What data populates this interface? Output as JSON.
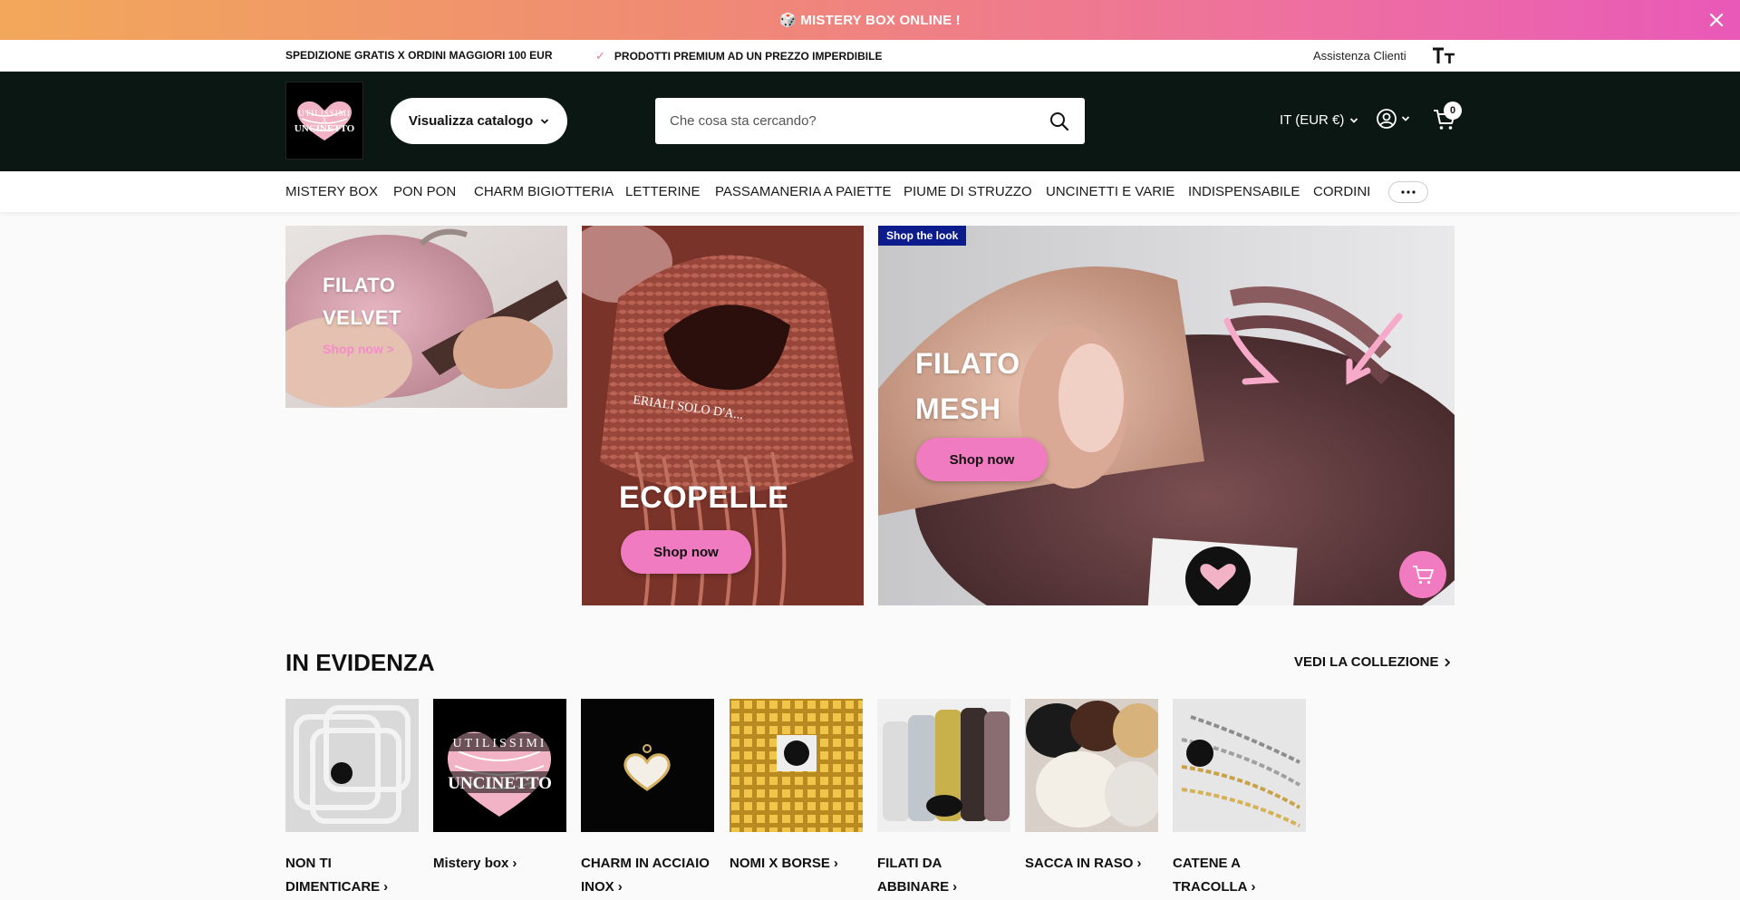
{
  "announcement": {
    "text": "🎲 MISTERY BOX ONLINE !",
    "close_icon": "close-icon"
  },
  "utility": {
    "usp_1": "SPEDIZIONE GRATIS X ORDINI MAGGIORI 100 EUR",
    "usp_2_check": "✓",
    "usp_2": "PRODOTTI PREMIUM AD UN PREZZO IMPERDIBILE",
    "help": "Assistenza Clienti",
    "text_size_icon": "text-size-icon"
  },
  "header": {
    "logo": {
      "line1": "UTILISSIMI",
      "line2": "X",
      "line3": "UNCINETTO"
    },
    "catalog_button": "Visualizza catalogo",
    "search_placeholder": "Che cosa sta cercando?",
    "locale": "IT (EUR €)",
    "cart_count": "0"
  },
  "nav": {
    "items": [
      "MISTERY BOX",
      "PON PON",
      "CHARM BIGIOTTERIA",
      "LETTERINE",
      "PASSAMANERIA A PAIETTE",
      "PIUME DI STRUZZO",
      "UNCINETTI E VARIE",
      "INDISPENSABILE",
      "CORDINI"
    ],
    "more_icon": "more-dots-icon"
  },
  "hero": {
    "velvet": {
      "title_1": "FILATO",
      "title_2": "VELVET",
      "link": "Shop now >"
    },
    "ecopelle": {
      "title": "ECOPELLE",
      "button": "Shop now",
      "photo_text": "ERIALI SOLO D'A..."
    },
    "mesh": {
      "tag": "Shop the look",
      "title_1": "FILATO",
      "title_2": "MESH",
      "button": "Shop now"
    }
  },
  "featured": {
    "title": "IN EVIDENZA",
    "view_all": "VEDI LA COLLEZIONE",
    "products": [
      {
        "line1": "NON TI",
        "line2": "DIMENTICARE"
      },
      {
        "line1": "Mistery box",
        "line2": ""
      },
      {
        "line1": "CHARM IN ACCIAIO",
        "line2": "INOX"
      },
      {
        "line1": "NOMI X BORSE",
        "line2": ""
      },
      {
        "line1": "FILATI DA",
        "line2": "ABBINARE"
      },
      {
        "line1": "SACCA IN RASO",
        "line2": ""
      },
      {
        "line1": "CATENE A",
        "line2": "TRACOLLA"
      }
    ]
  },
  "colors": {
    "brand_pink": "#f07bc0",
    "header_dark": "#0b1712",
    "tag_blue": "#0d1c8c"
  }
}
